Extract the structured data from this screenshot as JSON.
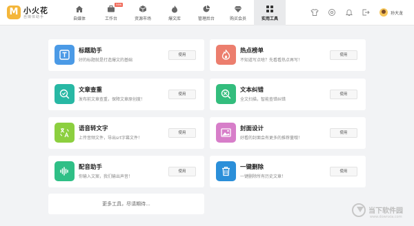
{
  "app": {
    "logo_mark": "M",
    "name": "小火花",
    "subtitle": "自媒体助手"
  },
  "nav": [
    {
      "label": "自媒体",
      "icon": "home-icon"
    },
    {
      "label": "工作台",
      "icon": "briefcase-icon",
      "badge": "new"
    },
    {
      "label": "资源市场",
      "icon": "cube-icon"
    },
    {
      "label": "爆文库",
      "icon": "flame-icon"
    },
    {
      "label": "管理后台",
      "icon": "pie-chart-icon"
    },
    {
      "label": "购买会员",
      "icon": "diamond-icon"
    },
    {
      "label": "实用工具",
      "icon": "grid-icon",
      "active": true
    }
  ],
  "toolbar_icons": [
    "shirt-icon",
    "settings-icon",
    "bell-icon",
    "logout-icon"
  ],
  "user": {
    "name": "孙大龙"
  },
  "use_label": "使用",
  "cards": [
    {
      "title": "标题助手",
      "desc": "好的标题就是打造爆文的基础",
      "color": "#4b9ae6",
      "icon": "text-title-icon"
    },
    {
      "title": "热点榜单",
      "desc": "不知道写点啥？先看看热点再写！",
      "color": "#ec7e6e",
      "icon": "flame-icon"
    },
    {
      "title": "文章查重",
      "desc": "发布前文章查重，保障文章原创度！",
      "color": "#28b8a4",
      "icon": "search-check-icon"
    },
    {
      "title": "文本纠错",
      "desc": "全文扫描，智能查错纠错",
      "color": "#33bd7d",
      "icon": "zoom-plus-icon"
    },
    {
      "title": "语音转文字",
      "desc": "上传音频文件，导出srt字幕文件！",
      "color": "#8ccf3f",
      "icon": "translate-icon"
    },
    {
      "title": "封面设计",
      "desc": "好看的封面会有更多的推荐量哦！",
      "color": "#d77ec9",
      "icon": "image-icon"
    },
    {
      "title": "配音助手",
      "desc": "你输入文案，我们输出声音！",
      "color": "#2fbf86",
      "icon": "audio-wave-icon"
    },
    {
      "title": "一键删除",
      "desc": "一键删除所有历史文章！",
      "color": "#2b8fd9",
      "icon": "trash-icon"
    }
  ],
  "more": "更多工具，尽请期待...",
  "watermark": {
    "text": "当下软件园",
    "url": "www.downxia.com"
  }
}
